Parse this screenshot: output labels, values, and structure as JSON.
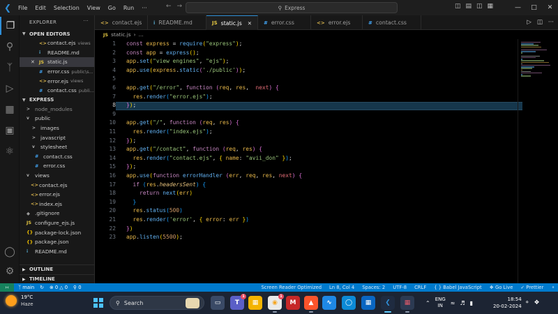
{
  "window": {
    "menu": [
      "File",
      "Edit",
      "Selection",
      "View",
      "Go",
      "Run"
    ],
    "more_menu": "···",
    "search_text": "Express"
  },
  "sidebar": {
    "title": "EXPLORER",
    "open_editors_label": "OPEN EDITORS",
    "open_editors": [
      {
        "name": "contact.ejs",
        "hint": "views",
        "icon": "<>"
      },
      {
        "name": "README.md",
        "hint": "",
        "icon": "i"
      },
      {
        "name": "static.js",
        "hint": "",
        "icon": "JS"
      },
      {
        "name": "error.css",
        "hint": "public\\s...",
        "icon": "#"
      },
      {
        "name": "error.ejs",
        "hint": "views",
        "icon": "<>"
      },
      {
        "name": "contact.css",
        "hint": "publi...",
        "icon": "#"
      }
    ],
    "folder_label": "EXPRESS",
    "tree": [
      {
        "name": "node_modules",
        "icon": ">"
      },
      {
        "name": "public",
        "icon": "v"
      },
      {
        "name": "images",
        "icon": ">"
      },
      {
        "name": "javascript",
        "icon": ">"
      },
      {
        "name": "stylesheet",
        "icon": "v"
      },
      {
        "name": "contact.css",
        "icon": "#"
      },
      {
        "name": "error.css",
        "icon": "#"
      },
      {
        "name": "views",
        "icon": "v"
      },
      {
        "name": "contact.ejs",
        "icon": "<>"
      },
      {
        "name": "error.ejs",
        "icon": "<>"
      },
      {
        "name": "index.ejs",
        "icon": "<>"
      },
      {
        "name": ".gitignore",
        "icon": "◆"
      },
      {
        "name": "configure_ejs.js",
        "icon": "JS"
      },
      {
        "name": "package-lock.json",
        "icon": "{}"
      },
      {
        "name": "package.json",
        "icon": "{}"
      },
      {
        "name": "README.md",
        "icon": "i"
      }
    ],
    "outline_label": "OUTLINE",
    "timeline_label": "TIMELINE"
  },
  "tabs": [
    {
      "name": "contact.ejs",
      "icon": "<>",
      "active": false
    },
    {
      "name": "README.md",
      "icon": "i",
      "active": false
    },
    {
      "name": "static.js",
      "icon": "JS",
      "active": true
    },
    {
      "name": "error.css",
      "icon": "#",
      "active": false
    },
    {
      "name": "error.ejs",
      "icon": "<>",
      "active": false
    },
    {
      "name": "contact.css",
      "icon": "#",
      "active": false
    }
  ],
  "breadcrumb": {
    "file": "static.js",
    "rest": "..."
  },
  "editor": {
    "current_line": 8,
    "lines": [
      "const express = require(\"express\");",
      "const app = express();",
      "app.set(\"view engines\", \"ejs\");",
      "app.use(express.static('./public'));",
      "",
      "app.get(\"/error\", function (req, res,  next) {",
      "  res.render(\"error.ejs\");",
      "});",
      "",
      "app.get(\"/\", function (req, res) {",
      "  res.render(\"index.ejs\");",
      "});",
      "app.get(\"/contact\", function (req, res) {",
      "  res.render(\"contact.ejs\", { name: \"avii_don\" });",
      "});",
      "app.use(function errorHandler (err, req, res, next) {",
      "  if (res.headersSent) {",
      "    return next(err)",
      "  }",
      "  res.status(500)",
      "  res.render('error', { error: err })",
      "})",
      "app.listen(5500);"
    ]
  },
  "statusbar": {
    "branch": "main",
    "errors": "0",
    "warnings": "0",
    "ports": "0",
    "screen_reader": "Screen Reader Optimized",
    "position": "Ln 8, Col 4",
    "spaces": "Spaces: 2",
    "encoding": "UTF-8",
    "eol": "CRLF",
    "language": "Babel JavaScript",
    "golive": "Go Live",
    "prettier": "Prettier"
  },
  "taskbar": {
    "weather_temp": "19°C",
    "weather_cond": "Haze",
    "search_label": "Search",
    "lang1": "ENG",
    "lang2": "IN",
    "time": "18:54",
    "date": "20-02-2024",
    "badge_a": "1",
    "badge_b": "1"
  },
  "colors": {
    "accent": "#007acc",
    "keyword": "#c586c0",
    "string": "#98c379",
    "method": "#61afef",
    "variable": "#e8b84a"
  }
}
